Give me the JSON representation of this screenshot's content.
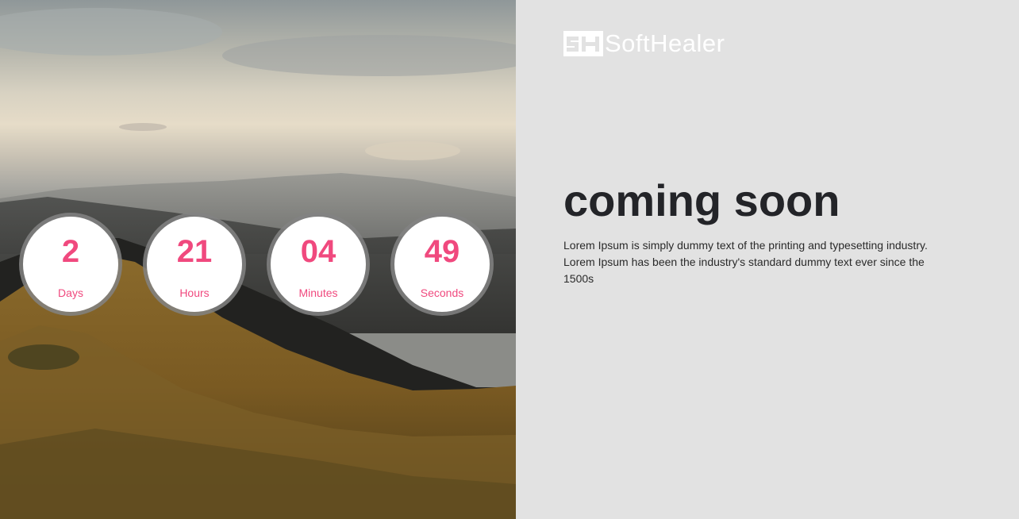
{
  "countdown": [
    {
      "value": "2",
      "unit": "Days"
    },
    {
      "value": "21",
      "unit": "Hours"
    },
    {
      "value": "04",
      "unit": "Minutes"
    },
    {
      "value": "49",
      "unit": "Seconds"
    }
  ],
  "brand": {
    "mark": "SH",
    "name": "SoftHealer"
  },
  "hero": {
    "title": "coming soon",
    "description": "Lorem Ipsum is simply dummy text of the printing and typesetting industry. Lorem Ipsum has been the industry's standard dummy text ever since the 1500s"
  },
  "colors": {
    "accent": "#f0497e",
    "panel_background": "#e2e2e2",
    "title": "#232428"
  },
  "background_image": "mountain-landscape-photo"
}
